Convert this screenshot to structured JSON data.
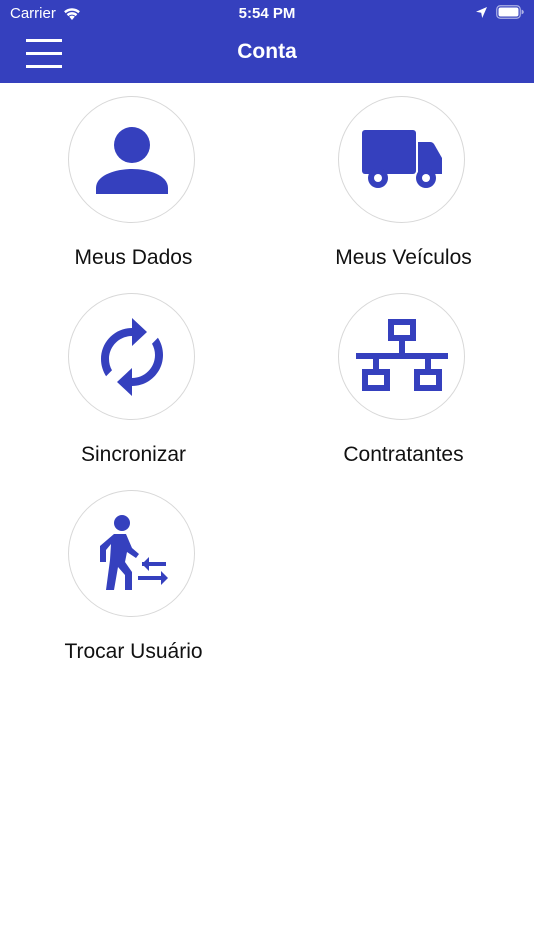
{
  "status_bar": {
    "carrier": "Carrier",
    "time": "5:54 PM"
  },
  "nav": {
    "title": "Conta"
  },
  "colors": {
    "brand": "#3540BE",
    "icon": "#3540BE",
    "background": "#FFFFFF"
  },
  "menu": {
    "items": [
      {
        "label": "Meus Dados",
        "icon": "person-icon"
      },
      {
        "label": "Meus Veículos",
        "icon": "truck-icon"
      },
      {
        "label": "Sincronizar",
        "icon": "sync-icon"
      },
      {
        "label": "Contratantes",
        "icon": "network-icon"
      },
      {
        "label": "Trocar Usuário",
        "icon": "switch-user-icon"
      }
    ]
  }
}
